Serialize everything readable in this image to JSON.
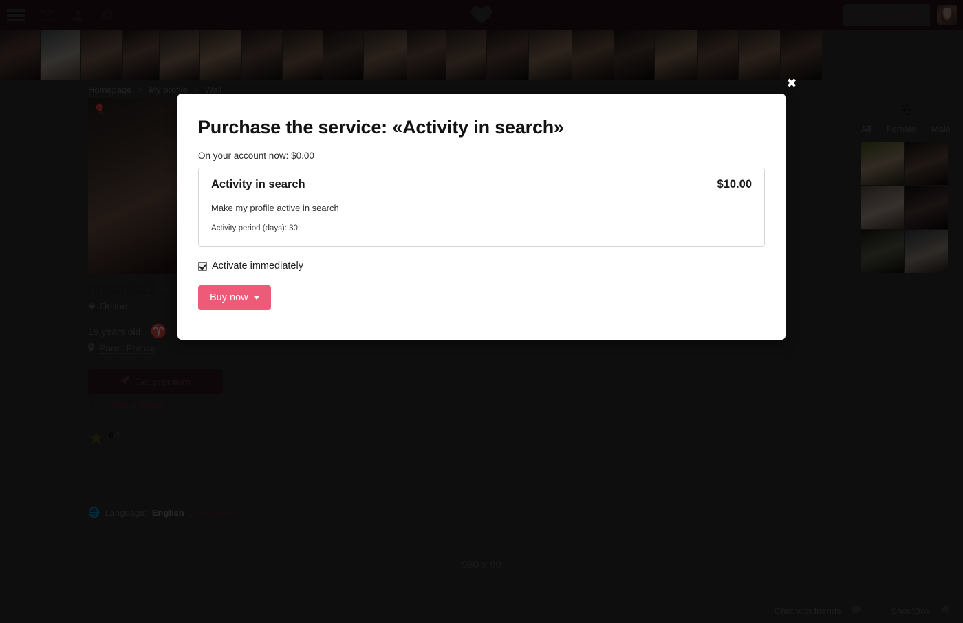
{
  "navbar": {
    "menu_icon": "hamburger-menu-icon",
    "icons": [
      "envelope-icon",
      "user-icon",
      "gear-icon"
    ],
    "logo_icon": "heart-logo-icon",
    "find_people_label": "Find people",
    "search_icon": "search-icon",
    "avatar": "user-avatar"
  },
  "photo_strip": {
    "count": 20,
    "gradients": [
      "linear-gradient(160deg,#2b2220 0%,#6b4a42 45%,#17100f 100%)",
      "linear-gradient(160deg,#4d5a60 0%,#b9b0a4 55%,#5a4a42 100%)",
      "linear-gradient(160deg,#3a2e2a 0%,#8a6a58 50%,#201614 100%)",
      "linear-gradient(160deg,#211a18 0%,#7a5a4e 45%,#120c0b 100%)",
      "linear-gradient(160deg,#35302c 0%,#9a7a66 55%,#1c1412 100%)",
      "linear-gradient(160deg,#44392f 0%,#a8866c 50%,#241a16 100%)",
      "linear-gradient(160deg,#262220 0%,#6d5248 45%,#141010 100%)",
      "linear-gradient(160deg,#2e2622 0%,#8c6a56 55%,#1a1210 100%)",
      "linear-gradient(160deg,#1e1a18 0%,#5e4840 45%,#0f0b0a 100%)",
      "linear-gradient(160deg,#3b3330 0%,#97765f 50%,#201816 100%)",
      "linear-gradient(160deg,#2a2422 0%,#7c5c4e 45%,#161010 100%)",
      "linear-gradient(160deg,#332b28 0%,#8a6a58 55%,#1a1412 100%)",
      "linear-gradient(160deg,#241e1c 0%,#6a4e44 45%,#120e0d 100%)",
      "linear-gradient(160deg,#3e3430 0%,#a07c64 50%,#221a16 100%)",
      "linear-gradient(160deg,#2c2522 0%,#80604e 45%,#171110 100%)",
      "linear-gradient(160deg,#1c1816 0%,#5a443c 45%,#0e0a09 100%)",
      "linear-gradient(160deg,#363029 0%,#9c7c62 50%,#1e1613 100%)",
      "linear-gradient(160deg,#292320 0%,#7a5a4a 45%,#151010 100%)",
      "linear-gradient(160deg,#3a322e 0%,#94725c 50%,#1f1714 100%)",
      "linear-gradient(160deg,#231d1b 0%,#6b4f44 45%,#110d0c 100%)"
    ],
    "widths": [
      58,
      58,
      60,
      52,
      58,
      60,
      58,
      58,
      58,
      62,
      56,
      58,
      60,
      62,
      60,
      58,
      62,
      58,
      60,
      60
    ]
  },
  "breadcrumb": {
    "items": [
      "Homepage",
      "My profile",
      "Wall"
    ],
    "separator": ">"
  },
  "profile": {
    "balloon_icon": "balloon-icon",
    "name": "miranda3",
    "edit_icon": "pencil-edit-icon",
    "status": "Online",
    "status_icon": "clock-icon",
    "age": "19 years old",
    "zodiac_icon": "aries-zodiac-icon",
    "zodiac_glyph": "♈",
    "location": "Paris, France",
    "location_icon": "map-pin-icon",
    "premium_label": "Get premium",
    "premium_icon": "rocket-icon",
    "more_label": "•••",
    "invite_label": "Invite a friend",
    "invite_icon": "user-plus-icon",
    "rating_icon": "star-icon",
    "rating_value": "0",
    "rating_max": "/5",
    "rating_sub": "3"
  },
  "language": {
    "globe_icon": "globe-icon",
    "label": "Language:",
    "current": "English",
    "comma": ",",
    "alternate": "Русский"
  },
  "right_panel": {
    "refresh_icon": "refresh-icon",
    "tabs": [
      {
        "label": "All",
        "active": true
      },
      {
        "label": "Female",
        "active": false
      },
      {
        "label": "Male",
        "active": false
      }
    ],
    "photos": [
      "linear-gradient(160deg,#52601f 0%,#b39a7e 50%,#2a2a14 100%)",
      "linear-gradient(160deg,#1a1612 0%,#6e5446 50%,#0d0a08 100%)",
      "linear-gradient(160deg,#6a5c54 0%,#c4b0a2 55%,#4a3c34 100%)",
      "linear-gradient(160deg,#121010 0%,#5c4440 50%,#080606 100%)",
      "linear-gradient(160deg,#1c2016 0%,#6a6a56 50%,#0e100a 100%)",
      "linear-gradient(160deg,#3c464e 0%,#a89a8c 55%,#2a2420 100%)"
    ]
  },
  "ad": {
    "placeholder": "980 x 90"
  },
  "bottom_bar": {
    "chat_label": "Chat with friends",
    "chat_icon": "comment-icon",
    "shoutbox_label": "ShoutBox",
    "shoutbox_icon": "megaphone-icon"
  },
  "modal": {
    "close_icon": "close-icon",
    "title": "Purchase the service:  «Activity in search»",
    "balance_label": "On your account now: $0.00",
    "service": {
      "name": "Activity in search",
      "price": "$10.00",
      "description": "Make my profile active in search",
      "period": "Activity period (days): 30"
    },
    "activate_label": "Activate immediately",
    "activate_checked": true,
    "buy_label": "Buy now"
  },
  "colors": {
    "navbar_bg": "#2e1419",
    "page_bg": "#333333",
    "accent_pink": "#ef5a78",
    "link_red": "#6a2a33",
    "premium_bg": "#351a21"
  }
}
